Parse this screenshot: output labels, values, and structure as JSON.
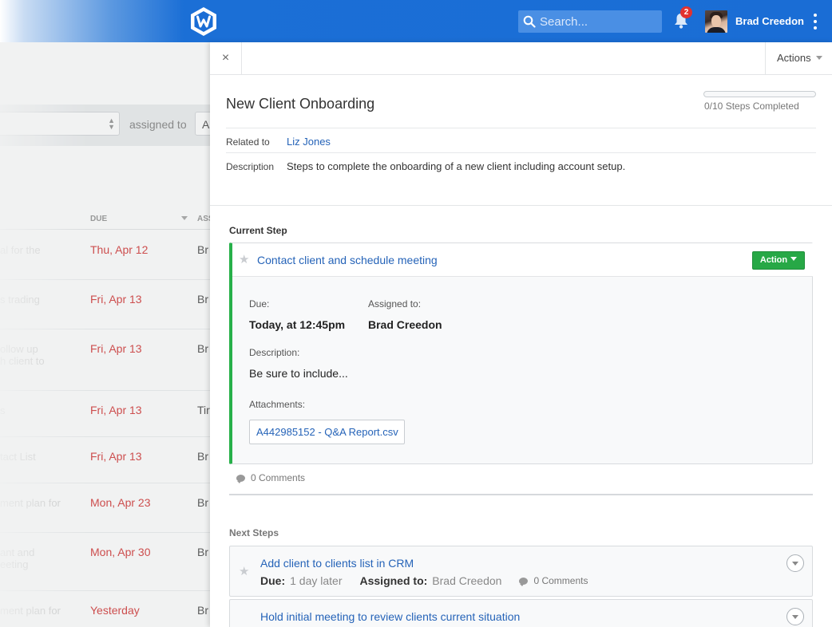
{
  "header": {
    "search_placeholder": "Search...",
    "notification_count": "2",
    "user_name": "Brad Creedon"
  },
  "background_list": {
    "assigned_label": "assigned to",
    "assigned_value": "A",
    "columns": {
      "due": "DUE",
      "assigned": "ASS"
    },
    "rows": [
      {
        "task": "al for the",
        "due": "Thu, Apr 12",
        "assigned": "Br"
      },
      {
        "task": "s trading",
        "due": "Fri, Apr 13",
        "assigned": "Br"
      },
      {
        "task": "ollow up\nh client to",
        "due": "Fri, Apr 13",
        "assigned": "Br"
      },
      {
        "task": "s",
        "due": "Fri, Apr 13",
        "assigned": "Tir"
      },
      {
        "task": "tact List",
        "due": "Fri, Apr 13",
        "assigned": "Br"
      },
      {
        "task": "ment plan for",
        "due": "Mon, Apr 23",
        "assigned": "Br"
      },
      {
        "task": "ant and\neeting",
        "due": "Mon, Apr 30",
        "assigned": "Br"
      },
      {
        "task": "ment plan for",
        "due": "Yesterday",
        "assigned": "Br"
      }
    ]
  },
  "panel": {
    "close_label": "×",
    "actions_label": "Actions",
    "title": "New Client Onboarding",
    "progress_fraction": 0,
    "progress_text": "0/10 Steps Completed",
    "related_label": "Related to",
    "related_value": "Liz Jones",
    "description_label": "Description",
    "description_value": "Steps to complete the onboarding of a new client including account setup."
  },
  "current_step": {
    "section_title": "Current Step",
    "title": "Contact client and schedule meeting",
    "action_label": "Action",
    "due_label": "Due:",
    "due_value": "Today, at 12:45pm",
    "assigned_label": "Assigned to:",
    "assigned_value": "Brad Creedon",
    "description_label": "Description:",
    "description_value": "Be sure to include...",
    "attachments_label": "Attachments:",
    "attachment_name": "A442985152 - Q&A Report.csv",
    "comments": "0 Comments"
  },
  "next_steps": {
    "section_title": "Next Steps",
    "items": [
      {
        "title": "Add client to clients list in CRM",
        "due_label": "Due:",
        "due_value": "1 day later",
        "assigned_label": "Assigned to:",
        "assigned_value": "Brad Creedon",
        "comments": "0 Comments"
      },
      {
        "title": "Hold initial meeting to review clients current situation"
      }
    ]
  },
  "colors": {
    "brand_blue": "#1a6dd5",
    "success_green": "#27a846",
    "link_blue": "#2563b8",
    "overdue_red": "#d64545"
  }
}
